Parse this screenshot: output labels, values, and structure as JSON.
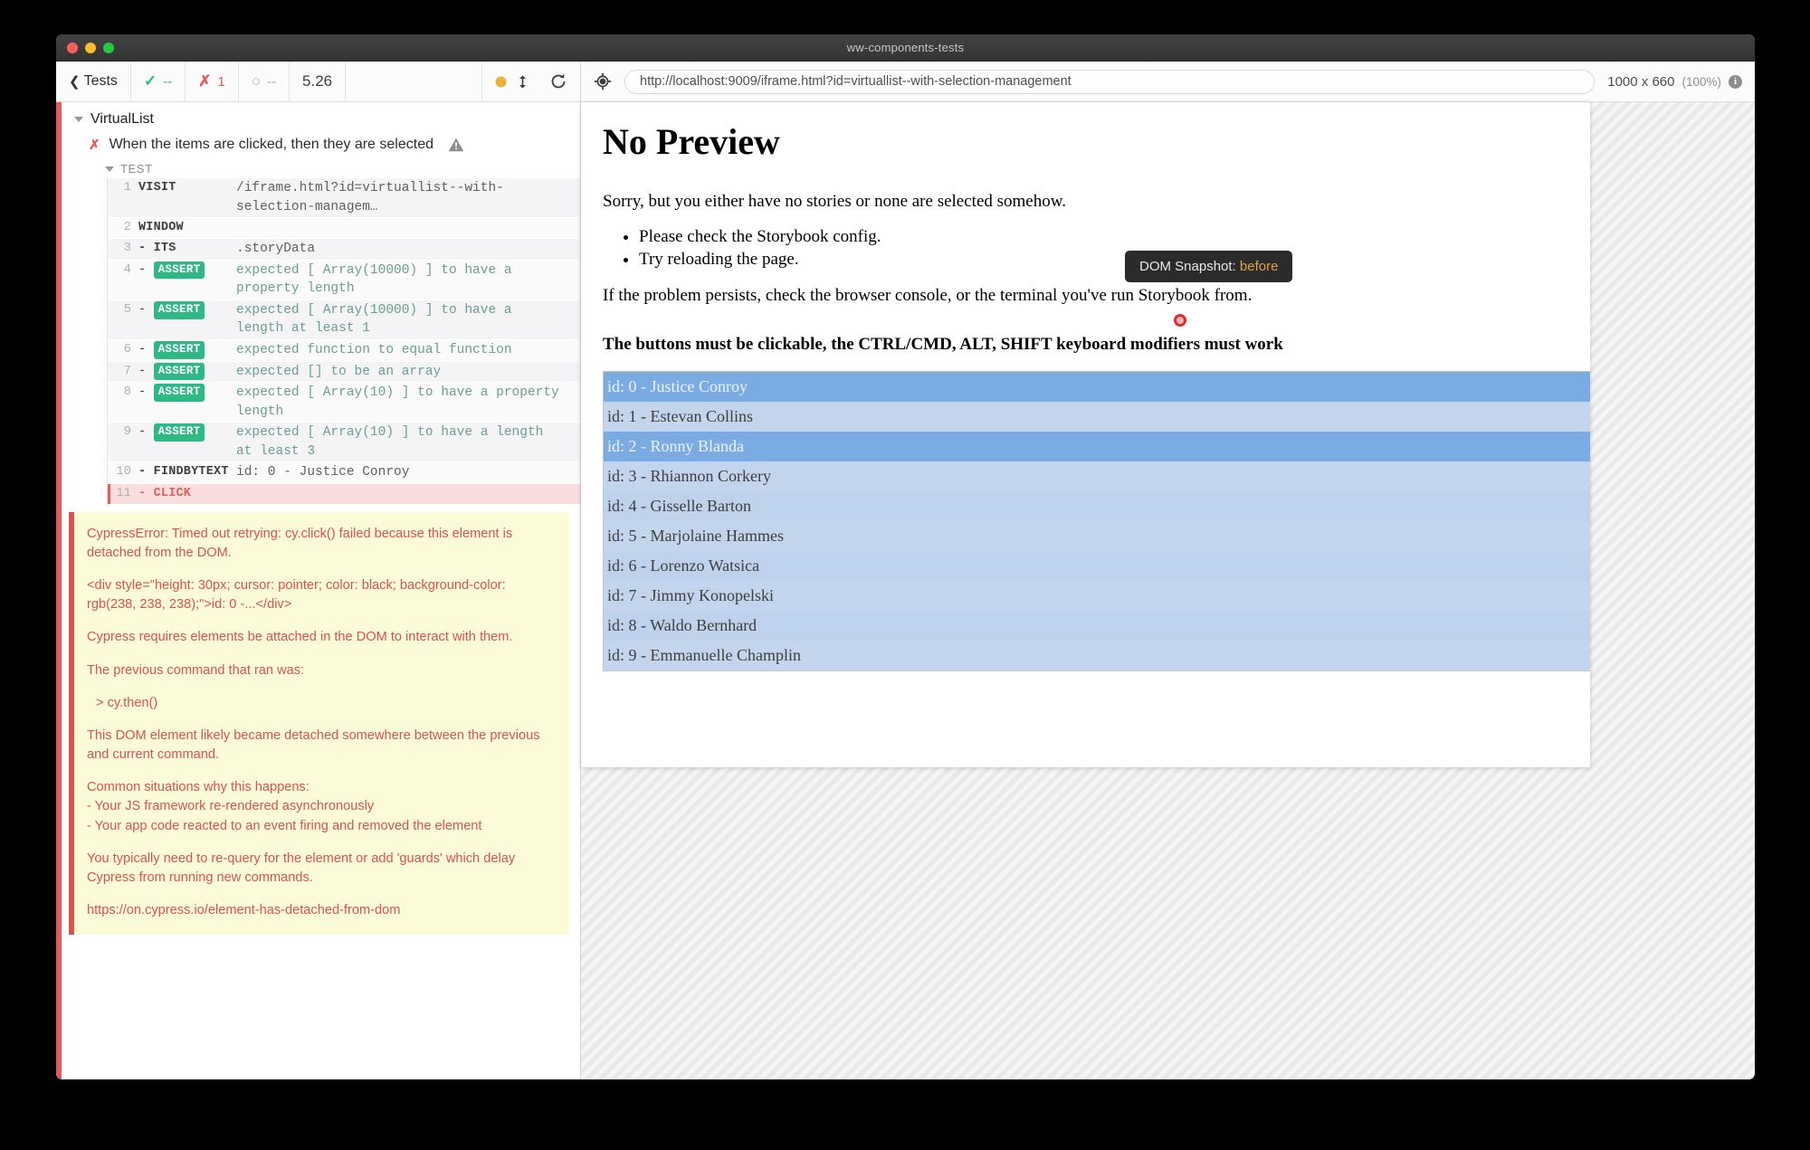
{
  "window": {
    "title": "ww-components-tests"
  },
  "reporter": {
    "back_label": "Tests",
    "stats": {
      "passed": "--",
      "failed": "1",
      "pending": "--",
      "duration": "5.26"
    },
    "suite": "VirtualList",
    "test": "When the items are clicked, then they are selected",
    "hook_label": "TEST",
    "commands": [
      {
        "num": "1",
        "name": "VISIT",
        "prefix": "",
        "assert": false,
        "message": "/iframe.html?id=virtuallist--with-selection-managem…",
        "plain": true
      },
      {
        "num": "2",
        "name": "WINDOW",
        "prefix": "",
        "assert": false,
        "message": "",
        "plain": true
      },
      {
        "num": "3",
        "name": "ITS",
        "prefix": "-",
        "assert": false,
        "message": ".storyData",
        "plain": true
      },
      {
        "num": "4",
        "name": "ASSERT",
        "prefix": "-",
        "assert": true,
        "message": "expected [ Array(10000) ] to have a property length"
      },
      {
        "num": "5",
        "name": "ASSERT",
        "prefix": "-",
        "assert": true,
        "message": "expected [ Array(10000) ] to have a length at least 1"
      },
      {
        "num": "6",
        "name": "ASSERT",
        "prefix": "-",
        "assert": true,
        "message": "expected function to equal function"
      },
      {
        "num": "7",
        "name": "ASSERT",
        "prefix": "-",
        "assert": true,
        "message": "expected [] to be an array"
      },
      {
        "num": "8",
        "name": "ASSERT",
        "prefix": "-",
        "assert": true,
        "message": "expected [ Array(10) ] to have a property length"
      },
      {
        "num": "9",
        "name": "ASSERT",
        "prefix": "-",
        "assert": true,
        "message": "expected [ Array(10) ] to have a length at least 3"
      },
      {
        "num": "10",
        "name": "FINDBYTEXT",
        "prefix": "-",
        "assert": false,
        "message": "id: 0 - Justice Conroy",
        "plain": true
      },
      {
        "num": "11",
        "name": "CLICK",
        "prefix": "-",
        "assert": false,
        "message": "",
        "plain": true,
        "failed": true
      }
    ],
    "error": {
      "line1": "CypressError: Timed out retrying: cy.click() failed because this element is detached from the DOM.",
      "line2": "<div style=\"height: 30px; cursor: pointer; color: black; background-color: rgb(238, 238, 238);\">id: 0 -...</div>",
      "line3": "Cypress requires elements be attached in the DOM to interact with them.",
      "line4": "The previous command that ran was:",
      "line5": "> cy.then()",
      "line6": "This DOM element likely became detached somewhere between the previous and current command.",
      "line7": "Common situations why this happens:\n  - Your JS framework re-rendered asynchronously\n  - Your app code reacted to an event firing and removed the element",
      "line8": "You typically need to re-query for the element or add 'guards' which delay Cypress from running new commands.",
      "link": "https://on.cypress.io/element-has-detached-from-dom"
    }
  },
  "preview": {
    "url": "http://localhost:9009/iframe.html?id=virtuallist--with-selection-management",
    "viewport_size": "1000 x 660",
    "viewport_scale": "(100%)",
    "dom_snapshot_label": "DOM Snapshot:",
    "dom_snapshot_value": "before"
  },
  "aut": {
    "heading": "No Preview",
    "intro": "Sorry, but you either have no stories or none are selected somehow.",
    "bullets": [
      "Please check the Storybook config.",
      "Try reloading the page."
    ],
    "footnote": "If the problem persists, check the browser console, or the terminal you've run Storybook from.",
    "instruction": "The buttons must be clickable, the CTRL/CMD, ALT, SHIFT keyboard modifiers must work",
    "list_items": [
      {
        "label": "id: 0 - Justice Conroy",
        "selected": true
      },
      {
        "label": "id: 1 - Estevan Collins",
        "selected": false
      },
      {
        "label": "id: 2 - Ronny Blanda",
        "selected": true
      },
      {
        "label": "id: 3 - Rhiannon Corkery",
        "selected": false
      },
      {
        "label": "id: 4 - Gisselle Barton",
        "selected": false
      },
      {
        "label": "id: 5 - Marjolaine Hammes",
        "selected": false
      },
      {
        "label": "id: 6 - Lorenzo Watsica",
        "selected": false
      },
      {
        "label": "id: 7 - Jimmy Konopelski",
        "selected": false
      },
      {
        "label": "id: 8 - Waldo Bernhard",
        "selected": false
      },
      {
        "label": "id: 9 - Emmanuelle Champlin",
        "selected": false
      }
    ]
  },
  "colors": {
    "pass": "#2eb886",
    "fail": "#e45b5b",
    "selected_row": "#7aabe3",
    "row": "#bed2eb",
    "error_bg": "#fcfbd7",
    "marker": "#e02e2e"
  }
}
